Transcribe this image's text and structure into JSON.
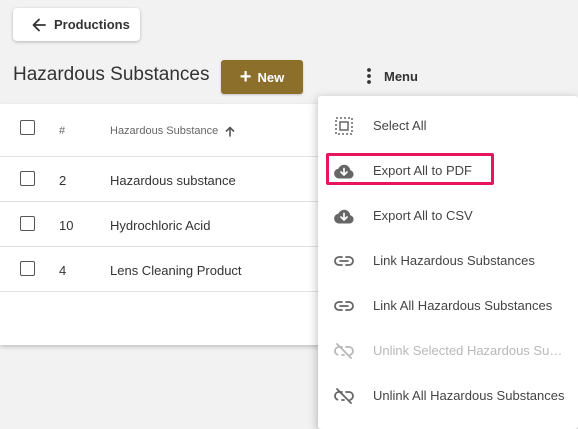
{
  "colors": {
    "accent": "#8c6f2b",
    "highlight": "#e8155c",
    "icon": "#666666",
    "icon_disabled": "#b8b8b8"
  },
  "header": {
    "back_label": "Productions",
    "back_icon": "arrow-left-icon",
    "title": "Hazardous Substances",
    "new_label": "New",
    "new_icon": "plus-icon",
    "menu_label": "Menu",
    "menu_icon": "more-vertical-icon"
  },
  "table": {
    "columns": {
      "number": "#",
      "name": "Hazardous Substance"
    },
    "sort": "ascending",
    "rows": [
      {
        "number": "2",
        "name": "Hazardous substance"
      },
      {
        "number": "10",
        "name": "Hydrochloric Acid"
      },
      {
        "number": "4",
        "name": "Lens Cleaning Product"
      }
    ]
  },
  "menu": {
    "items": [
      {
        "label": "Select All",
        "icon": "select-all-icon",
        "enabled": true
      },
      {
        "label": "Export All to PDF",
        "icon": "cloud-download-icon",
        "enabled": true,
        "highlighted": true
      },
      {
        "label": "Export All to CSV",
        "icon": "cloud-download-icon",
        "enabled": true
      },
      {
        "label": "Link Hazardous Substances",
        "icon": "link-icon",
        "enabled": true
      },
      {
        "label": "Link All Hazardous Substances",
        "icon": "link-icon",
        "enabled": true
      },
      {
        "label": "Unlink Selected Hazardous Substances",
        "icon": "link-off-icon",
        "enabled": false
      },
      {
        "label": "Unlink All Hazardous Substances",
        "icon": "link-off-icon",
        "enabled": true
      }
    ]
  }
}
